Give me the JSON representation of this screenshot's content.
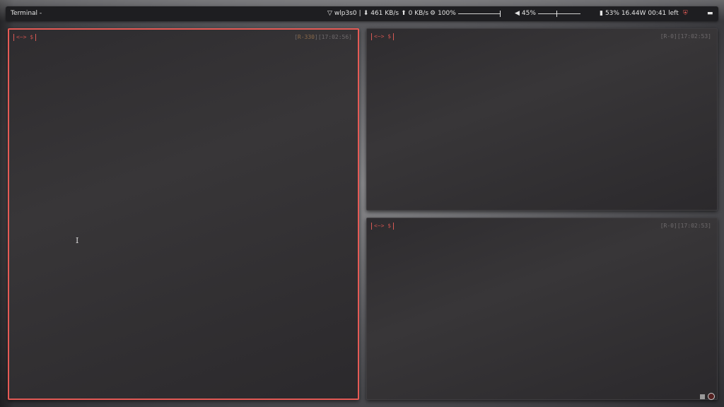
{
  "topbar": {
    "app_title": "Terminal -",
    "network": {
      "icon": "wifi-icon",
      "interface": "wlp3s0",
      "separator": "|",
      "down_icon": "download-icon",
      "down": "461 KB/s",
      "up_icon": "upload-icon",
      "up": "0 KB/s"
    },
    "brightness": {
      "icon": "brightness-icon",
      "value": "100%",
      "level": 1.0
    },
    "volume": {
      "icon": "volume-icon",
      "value": "45%",
      "level": 0.45
    },
    "battery": {
      "icon": "battery-icon",
      "text": "53% 16.44W 00:41 left"
    },
    "shield_icon": "shield-icon",
    "power_icon": "toggle-icon"
  },
  "panes": [
    {
      "id": "left",
      "prompt": "<~> $",
      "status_r": "R-330",
      "status_time": "17:02:56",
      "focused": true
    },
    {
      "id": "top-right",
      "prompt": "<~> $",
      "status_r": "R-0",
      "status_time": "17:02:53",
      "focused": false
    },
    {
      "id": "bottom-right",
      "prompt": "<~> $",
      "status_r": "R-0",
      "status_time": "17:02:53",
      "focused": false
    }
  ],
  "colors": {
    "accent": "#e55a55",
    "bar_bg": "#1e1e21",
    "pane_bg": "#333135"
  }
}
